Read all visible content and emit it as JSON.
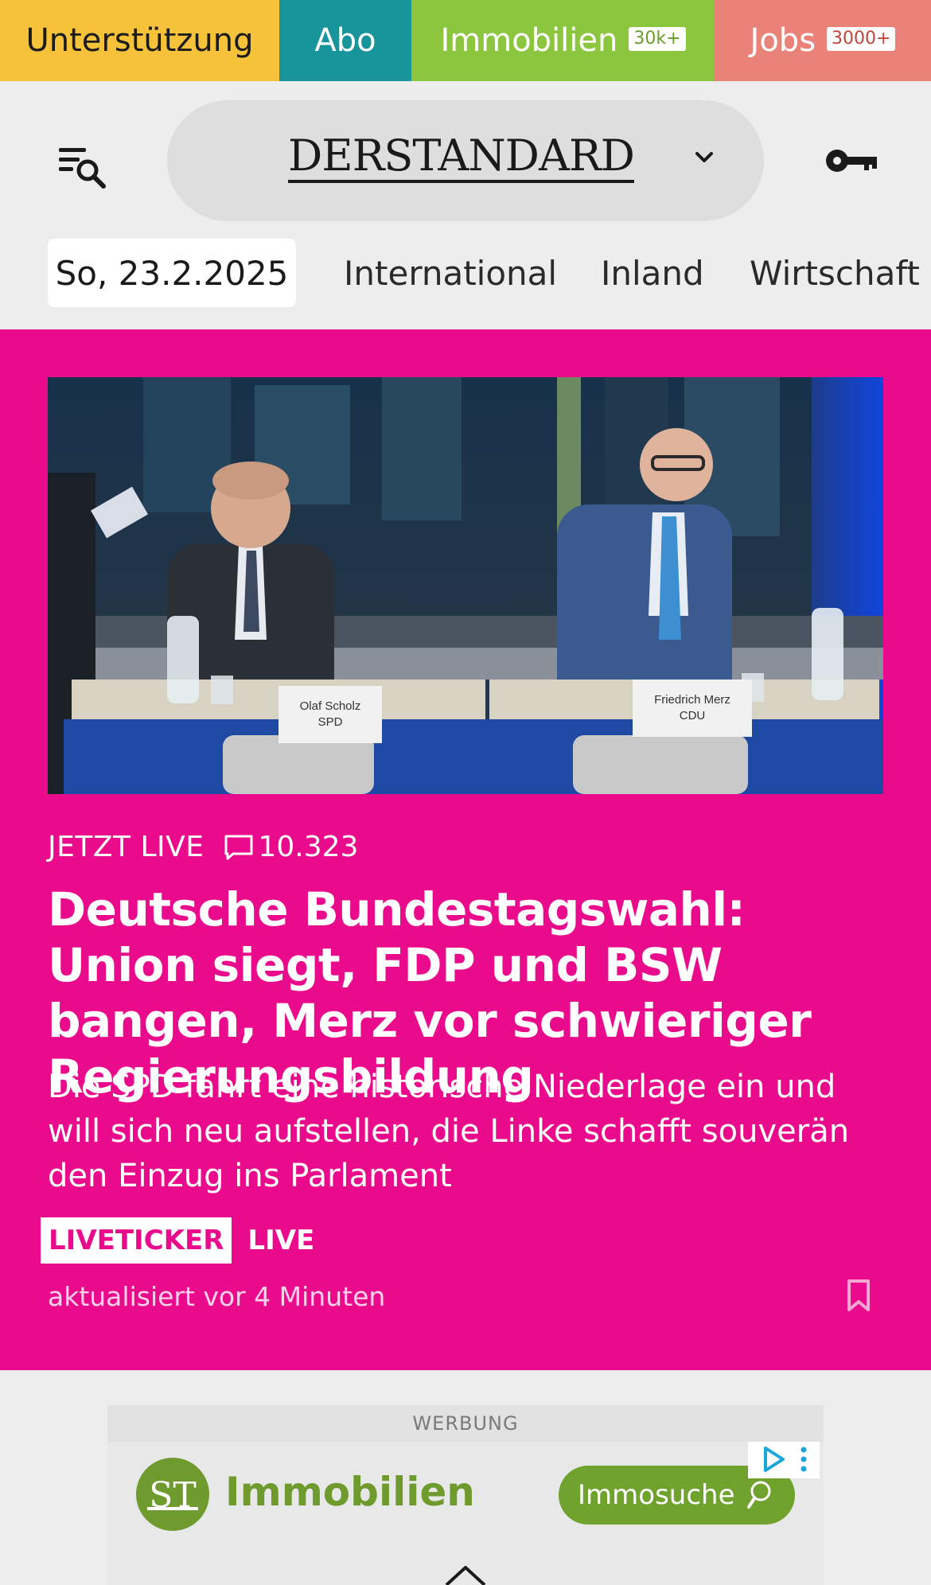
{
  "topbar": {
    "support_label": "Unterstützung",
    "abo_label": "Abo",
    "immo_label": "Immobilien",
    "immo_badge": "30k+",
    "jobs_label": "Jobs",
    "jobs_badge": "3000+",
    "colors": {
      "support": "#f5c239",
      "abo": "#17959a",
      "immo": "#8cc63f",
      "jobs": "#e98278"
    }
  },
  "header": {
    "logo_text": "DERSTANDARD",
    "menu_icon": "menu-search-icon",
    "account_icon": "key-icon"
  },
  "nav": {
    "date": "So, 23.2.2025",
    "items": [
      "International",
      "Inland",
      "Wirtschaft"
    ]
  },
  "hero": {
    "background": "#ea0a8c",
    "status": "JETZT LIVE",
    "comment_count": "10.323",
    "headline": "Deutsche Bundestagswahl: Union siegt, FDP und BSW bangen, Merz vor schwieriger Regierungsbildung",
    "lead": "Die SPD fährt eine historische Niederlage ein und will sich neu aufstellen, die Linke schafft souverän den Einzug ins Parlament",
    "tag_liveticker": "LIVETICKER",
    "tag_live": "LIVE",
    "updated": "aktualisiert vor 4 Minuten",
    "image": {
      "nameplate_left_name": "Olaf Scholz",
      "nameplate_left_party": "SPD",
      "nameplate_right_name": "Friedrich Merz",
      "nameplate_right_party": "CDU"
    }
  },
  "ad": {
    "label": "WERBUNG",
    "brand": "Immobilien",
    "button": "Immosuche",
    "accent": "#6fa32e"
  }
}
